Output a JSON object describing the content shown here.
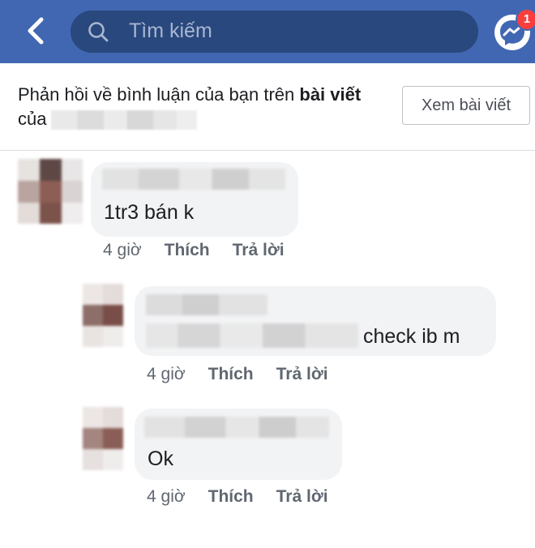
{
  "topbar": {
    "search_placeholder": "Tìm kiếm",
    "messenger_badge": "1",
    "color": "#4267b2"
  },
  "notice": {
    "text_prefix": "Phản hồi về bình luận của bạn trên ",
    "text_bold1": "bài viết",
    "text_suffix": " của",
    "view_post_label": "Xem bài viết"
  },
  "comments": [
    {
      "text": "1tr3 bán k",
      "time": "4 giờ",
      "like": "Thích",
      "reply": "Trả lời"
    },
    {
      "text": "check ib m",
      "time": "4 giờ",
      "like": "Thích",
      "reply": "Trả lời"
    },
    {
      "text": "Ok",
      "time": "4 giờ",
      "like": "Thích",
      "reply": "Trả lời"
    }
  ]
}
